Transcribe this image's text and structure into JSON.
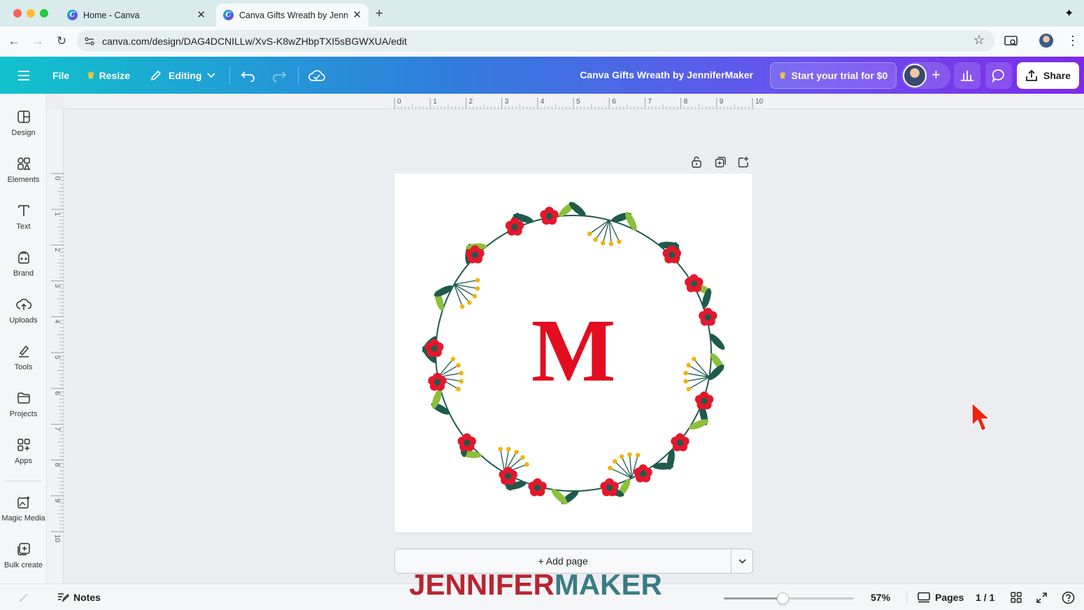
{
  "browser": {
    "tabs": [
      {
        "title": "Home - Canva",
        "active": false
      },
      {
        "title": "Canva Gifts Wreath by Jennif",
        "active": true
      }
    ],
    "url": "canva.com/design/DAG4DCNILLw/XvS-K8wZHbpTXI5sBGWXUA/edit"
  },
  "header": {
    "file_label": "File",
    "resize_label": "Resize",
    "editing_label": "Editing",
    "design_title": "Canva Gifts Wreath by JenniferMaker",
    "trial_label": "Start your trial for $0",
    "share_label": "Share"
  },
  "rail": {
    "items": [
      {
        "label": "Design",
        "icon": "design-icon"
      },
      {
        "label": "Elements",
        "icon": "elements-icon"
      },
      {
        "label": "Text",
        "icon": "text-icon"
      },
      {
        "label": "Brand",
        "icon": "brand-icon"
      },
      {
        "label": "Uploads",
        "icon": "uploads-icon"
      },
      {
        "label": "Tools",
        "icon": "tools-icon"
      },
      {
        "label": "Projects",
        "icon": "projects-icon"
      },
      {
        "label": "Apps",
        "icon": "apps-icon"
      },
      {
        "label": "Magic Media",
        "icon": "magic-media-icon"
      },
      {
        "label": "Bulk create",
        "icon": "bulk-create-icon"
      }
    ]
  },
  "rulers": {
    "top": [
      "0",
      "1",
      "2",
      "3",
      "4",
      "5",
      "6",
      "7",
      "8",
      "9",
      "10"
    ],
    "left": [
      "0",
      "1",
      "2",
      "3",
      "4",
      "5",
      "6",
      "7",
      "8",
      "9",
      "10"
    ]
  },
  "canvas": {
    "monogram": "M",
    "add_page_label": "+ Add page"
  },
  "footer": {
    "notes_label": "Notes",
    "zoom_fraction": 0.45,
    "zoom_label": "57%",
    "pages_label": "Pages",
    "page_count": "1 / 1"
  },
  "watermark": {
    "part1": "JENNIFER",
    "part2": "MAKER"
  },
  "colors": {
    "monogram_red": "#e30d1f",
    "header_start": "#10c3cc",
    "header_end": "#7d2ae8",
    "leaf_dark": "#1f5a4c",
    "leaf_light": "#8cbf3a",
    "berry": "#f0b400"
  }
}
